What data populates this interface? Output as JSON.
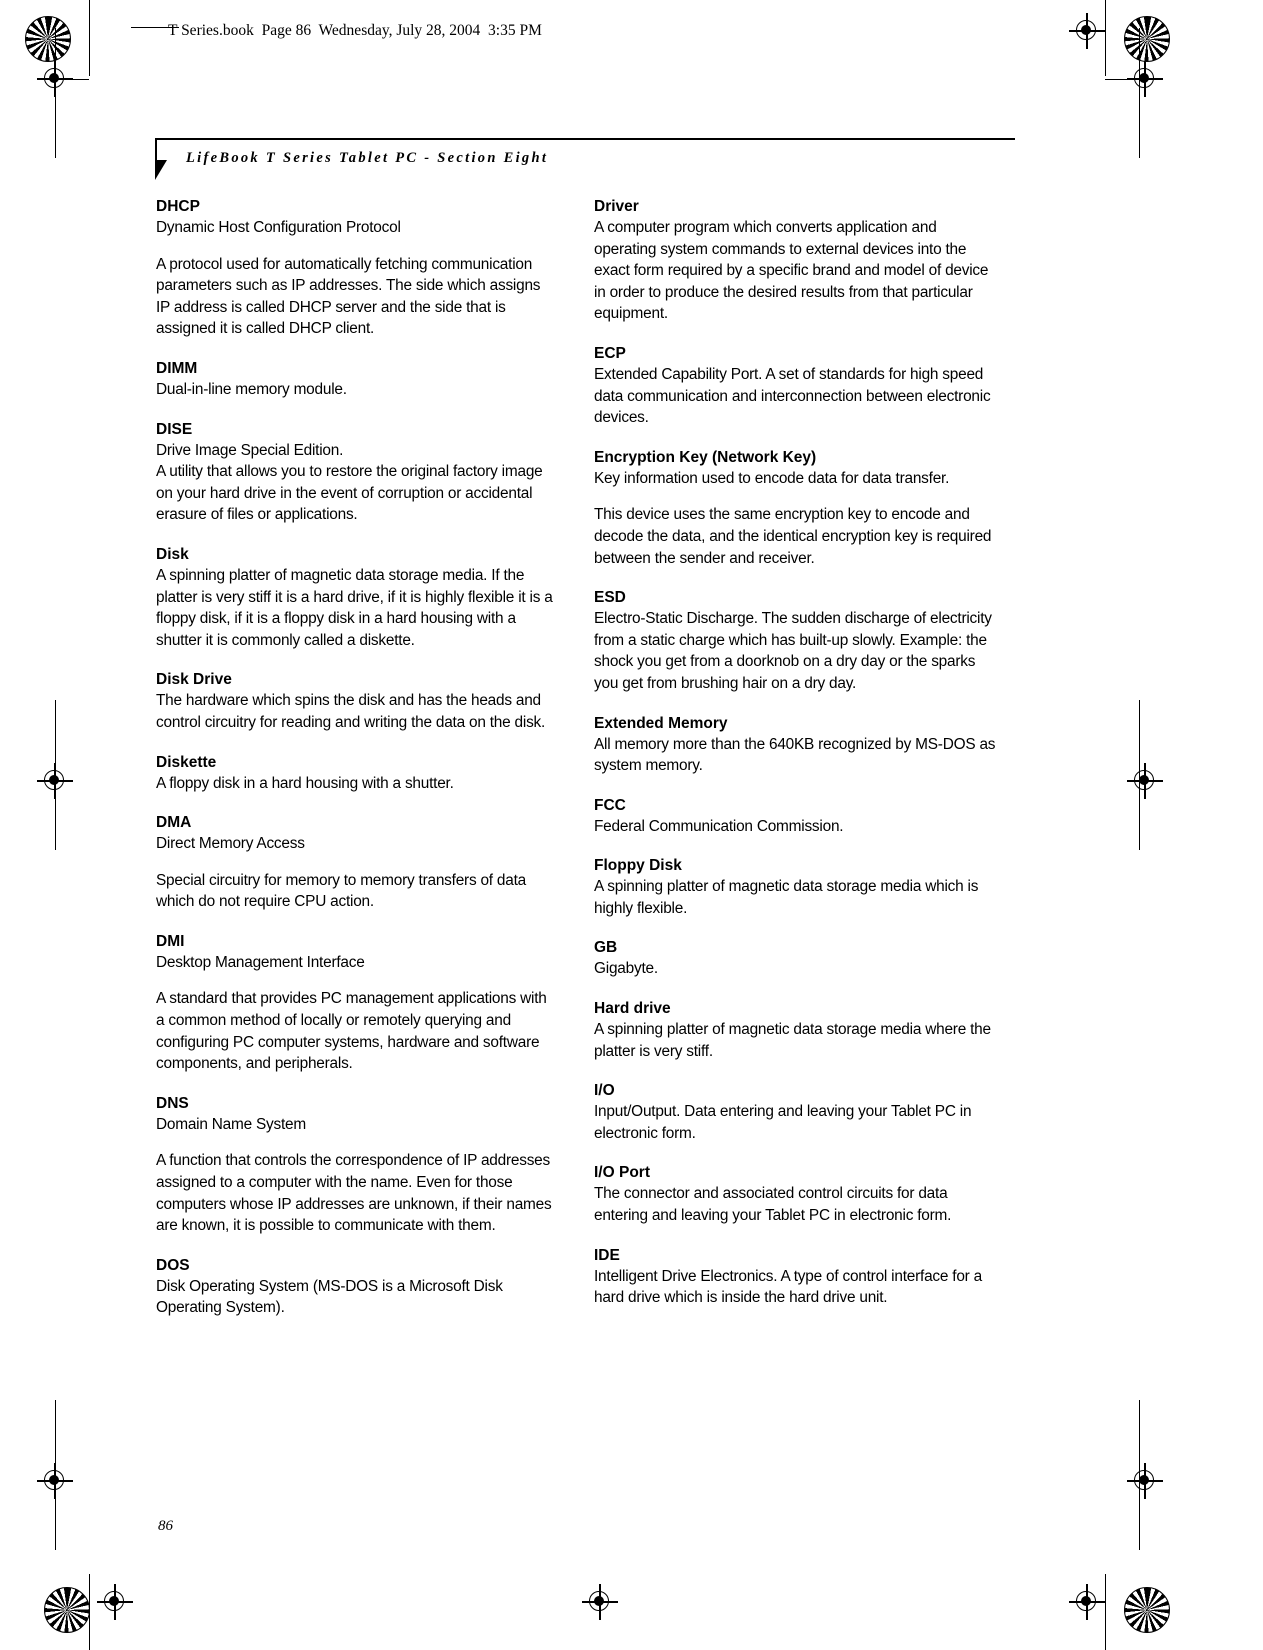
{
  "file_banner": "T Series.book  Page 86  Wednesday, July 28, 2004  3:35 PM",
  "running_head": "LifeBook T Series Tablet PC - Section Eight",
  "page_number": "86",
  "columns": {
    "left": [
      {
        "term": "DHCP",
        "paragraphs": [
          "Dynamic Host Configuration Protocol",
          "A protocol used for automatically fetching communication parameters such as IP addresses. The side which assigns IP address is called DHCP server and the side that is assigned it is called DHCP client."
        ],
        "spaced": true
      },
      {
        "term": "DIMM",
        "paragraphs": [
          "Dual-in-line memory module."
        ],
        "spaced": false
      },
      {
        "term": "DISE",
        "paragraphs": [
          "Drive Image Special Edition.",
          "A utility that allows you to restore the original factory image on your hard drive in the event of corruption or accidental erasure of files or applications."
        ],
        "spaced": false
      },
      {
        "term": "Disk",
        "paragraphs": [
          "A spinning platter of magnetic data storage media. If the platter is very stiff it is a hard drive, if it is highly flexible it is a floppy disk, if it is a floppy disk in a hard housing with a shutter it is commonly called a diskette."
        ],
        "spaced": false
      },
      {
        "term": "Disk Drive",
        "paragraphs": [
          "The hardware which spins the disk and has the heads and control circuitry for reading and writing the data on the disk."
        ],
        "spaced": false
      },
      {
        "term": "Diskette",
        "paragraphs": [
          "A floppy disk in a hard housing with a shutter."
        ],
        "spaced": false
      },
      {
        "term": "DMA",
        "paragraphs": [
          "Direct Memory Access",
          "Special circuitry for memory to memory transfers of data which do not require CPU action."
        ],
        "spaced": true
      },
      {
        "term": "DMI",
        "paragraphs": [
          "Desktop Management Interface",
          "A standard that provides PC management applications with a common method of locally or remotely querying and configuring PC computer systems, hardware and software components, and peripherals."
        ],
        "spaced": true
      },
      {
        "term": "DNS",
        "paragraphs": [
          "Domain Name System",
          "A function that controls the correspondence of IP addresses assigned to a computer with the name. Even for those computers whose IP addresses are unknown, if their names are known, it is possible to communicate with them."
        ],
        "spaced": true
      },
      {
        "term": "DOS",
        "paragraphs": [
          "Disk Operating System (MS-DOS is a Microsoft Disk Operating System)."
        ],
        "spaced": false
      }
    ],
    "right": [
      {
        "term": "Driver",
        "paragraphs": [
          "A computer program which converts application and operating system commands to external devices into the exact form required by a specific brand and model of device in order to produce the desired results from that particular equipment."
        ],
        "spaced": false
      },
      {
        "term": "ECP",
        "paragraphs": [
          "Extended Capability Port. A set of standards for high speed data communication and interconnection between electronic devices."
        ],
        "spaced": false
      },
      {
        "term": "Encryption Key (Network Key)",
        "paragraphs": [
          "Key information used to encode data for data transfer.",
          "This device uses the same encryption key to encode and decode the data, and the identical encryption key is required between the sender and receiver."
        ],
        "spaced": true
      },
      {
        "term": "ESD",
        "paragraphs": [
          "Electro-Static Discharge. The sudden discharge of electricity from a static charge which has built-up slowly. Example: the shock you get from a doorknob on a dry day or the sparks you get from brushing hair on a dry day."
        ],
        "spaced": false
      },
      {
        "term": "Extended Memory",
        "paragraphs": [
          "All memory more than the 640KB recognized by MS-DOS as system memory."
        ],
        "spaced": false
      },
      {
        "term": "FCC",
        "paragraphs": [
          "Federal Communication Commission."
        ],
        "spaced": false
      },
      {
        "term": "Floppy Disk",
        "paragraphs": [
          "A spinning platter of magnetic data storage media which is highly flexible."
        ],
        "spaced": false
      },
      {
        "term": "GB",
        "paragraphs": [
          "Gigabyte."
        ],
        "spaced": false
      },
      {
        "term": "Hard drive",
        "paragraphs": [
          "A spinning platter of magnetic data storage media where the platter is very stiff."
        ],
        "spaced": false
      },
      {
        "term": "I/O",
        "paragraphs": [
          "Input/Output. Data entering and leaving your Tablet PC in electronic form."
        ],
        "spaced": false
      },
      {
        "term": "I/O Port",
        "paragraphs": [
          "The connector and associated control circuits for data entering and leaving your Tablet PC in electronic form."
        ],
        "spaced": false
      },
      {
        "term": "IDE",
        "paragraphs": [
          "Intelligent Drive Electronics. A type of control interface for a hard drive which is inside the hard drive unit."
        ],
        "spaced": false
      }
    ]
  }
}
